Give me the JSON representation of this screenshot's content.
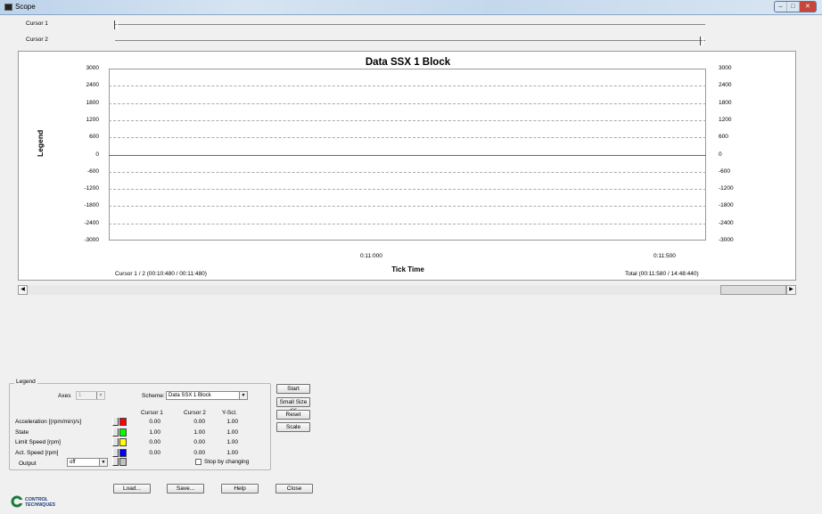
{
  "window": {
    "title": "Scope"
  },
  "cursors": {
    "cursor1_label": "Cursor 1",
    "cursor2_label": "Cursor 2"
  },
  "chart_data": {
    "type": "line",
    "title": "Data  SSX 1 Block",
    "ylabel": "Legend",
    "xlabel": "Tick Time",
    "ylim": [
      -3000,
      3000
    ],
    "yticks": [
      "3000",
      "2400",
      "1800",
      "1200",
      "600",
      "0",
      "-600",
      "-1200",
      "-1800",
      "-2400",
      "-3000"
    ],
    "xticks": [
      "0:11:000",
      "0:11:500"
    ],
    "grid": true,
    "series": [
      {
        "values": [
          0,
          0
        ],
        "color": "#2e8b57"
      }
    ]
  },
  "footer": {
    "cursor_info": "Cursor 1 / 2 (00:10:480 / 00:11:480)",
    "total_info": "Total (00:11:580 / 14:48:440)"
  },
  "legend_panel": {
    "group_label": "Legend",
    "axes_label": "Axes",
    "axes_value": "1",
    "scheme_label": "Scheme:",
    "scheme_value": "Data  SSX 1 Block",
    "col_cursor1": "Cursor 1",
    "col_cursor2": "Cursor 2",
    "col_yscl": "Y-Scl.",
    "rows": [
      {
        "name": "Acceleration [(rpm/min)/s]",
        "color": "#ff0000",
        "c1": "0.00",
        "c2": "0.00",
        "ys": "1.00"
      },
      {
        "name": "State",
        "color": "#00ff00",
        "c1": "1.00",
        "c2": "1.00",
        "ys": "1.00"
      },
      {
        "name": "Limit Speed [rpm]",
        "color": "#ffff00",
        "c1": "0.00",
        "c2": "0.00",
        "ys": "1.00"
      },
      {
        "name": "Act. Speed [rpm]",
        "color": "#0000ff",
        "c1": "0.00",
        "c2": "0.00",
        "ys": "1.00"
      }
    ],
    "output_label": "Output",
    "output_value": "off",
    "output_color": "#c0c0c0",
    "stop_label": "Stop by changing"
  },
  "side_buttons": {
    "start": "Start",
    "small_size": "Small Size <<",
    "reset": "Reset",
    "scale": "Scale"
  },
  "bottom_buttons": {
    "load": "Load...",
    "save": "Save...",
    "help": "Help",
    "close": "Close"
  },
  "logo": {
    "text_line1": "CONTROL",
    "text_line2": "TECHNIQUES"
  }
}
